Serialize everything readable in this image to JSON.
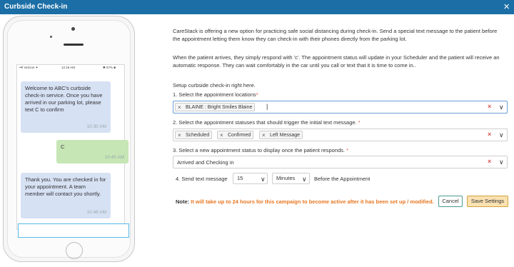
{
  "window": {
    "title": "Curbside Check-in",
    "close": "×"
  },
  "phone": {
    "status_left": "••ll Verizon ✦",
    "status_time": "12:18 AM",
    "status_right": "✱ 67% ■",
    "messages": [
      {
        "text": "Welcome to ABC's curbside check-in service. Once you have arrived in our parking lot, please text C to confirm",
        "time": "10:30 AM"
      },
      {
        "text": "C",
        "time": "10:45 AM"
      },
      {
        "text": "Thank you. You are checked in for your appointment. A team member will contact you shortly.",
        "time": "10:46 AM"
      }
    ]
  },
  "intro": {
    "p1": "CareStack is offering a new option for practicing safe social distancing during check-in. Send a special text message to the patient before the appointment letting them know they can check-in with their phones directly from the parking lot.",
    "p2": "When the patient arrives, they simply respond with 'c'. The appointment status will update in your Scheduler and the patient will receive an automatic response. They can wait comfortably in the car until you call or text that it is time to come in..",
    "setup": "Setup curbside check-in right here."
  },
  "step1": {
    "label": "1. Select the appointment locations",
    "req": "*",
    "chips": [
      "BLAINE : Bright Smiles Blaine"
    ]
  },
  "step2": {
    "label": "2. Select the appointment statuses that should trigger the initial text message.",
    "req": "*",
    "chips": [
      "Scheduled",
      "Confirmed",
      "Left Message"
    ]
  },
  "step3": {
    "label": "3. Select a new appointment status to display once the patient responds.",
    "req": "*",
    "value": "Arrived and Checking in"
  },
  "step4": {
    "label": "4. Send text message",
    "amount": "15",
    "unit": "Minutes",
    "suffix": "Before the Appointment"
  },
  "note": {
    "prefix": "Note:",
    "text": "It will take up to 24 hours for this campaign to become active after it has been set up / modified."
  },
  "buttons": {
    "cancel": "Cancel",
    "save": "Save Settings"
  },
  "icons": {
    "remove": "×",
    "clear": "×",
    "chevron": "∨"
  },
  "colors": {
    "titlebar": "#1c6fa6",
    "note": "#e87722",
    "save_bg": "#fbe2b2"
  }
}
